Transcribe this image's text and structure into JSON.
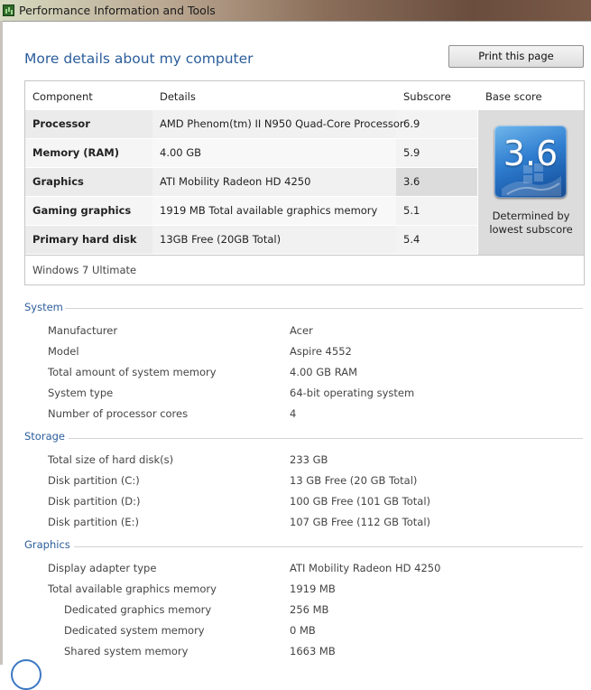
{
  "window": {
    "title": "Performance Information and Tools"
  },
  "page": {
    "title": "More details about my computer",
    "print_button": "Print this page"
  },
  "scores": {
    "headers": {
      "component": "Component",
      "details": "Details",
      "subscore": "Subscore",
      "base": "Base score"
    },
    "rows": [
      {
        "component": "Processor",
        "details": "AMD Phenom(tm) II N950 Quad-Core Processor",
        "subscore": "6.9"
      },
      {
        "component": "Memory (RAM)",
        "details": "4.00 GB",
        "subscore": "5.9"
      },
      {
        "component": "Graphics",
        "details": "ATI Mobility Radeon HD 4250",
        "subscore": "3.6"
      },
      {
        "component": "Gaming graphics",
        "details": "1919 MB Total available graphics memory",
        "subscore": "5.1"
      },
      {
        "component": "Primary hard disk",
        "details": "13GB Free (20GB Total)",
        "subscore": "5.4"
      }
    ],
    "base_score": "3.6",
    "base_caption_1": "Determined by",
    "base_caption_2": "lowest subscore",
    "os": "Windows 7 Ultimate"
  },
  "system": {
    "heading": "System",
    "items": [
      {
        "label": "Manufacturer",
        "value": "Acer"
      },
      {
        "label": "Model",
        "value": "Aspire 4552"
      },
      {
        "label": "Total amount of system memory",
        "value": "4.00 GB RAM"
      },
      {
        "label": "System type",
        "value": "64-bit operating system"
      },
      {
        "label": "Number of processor cores",
        "value": "4"
      }
    ]
  },
  "storage": {
    "heading": "Storage",
    "items": [
      {
        "label": "Total size of hard disk(s)",
        "value": "233 GB"
      },
      {
        "label": "Disk partition (C:)",
        "value": "13 GB Free (20 GB Total)"
      },
      {
        "label": "Disk partition (D:)",
        "value": "100 GB Free (101 GB Total)"
      },
      {
        "label": "Disk partition (E:)",
        "value": "107 GB Free (112 GB Total)"
      }
    ]
  },
  "graphics": {
    "heading": "Graphics",
    "items": [
      {
        "label": "Display adapter type",
        "value": "ATI Mobility Radeon HD 4250"
      },
      {
        "label": "Total available graphics memory",
        "value": "1919 MB"
      },
      {
        "label": "Dedicated graphics memory",
        "value": "256 MB"
      },
      {
        "label": "Dedicated system memory",
        "value": "0 MB"
      },
      {
        "label": "Shared system memory",
        "value": "1663 MB"
      }
    ]
  },
  "icons": {
    "app": "performance-chart-icon",
    "badge": "windows-flag-icon"
  },
  "colors": {
    "heading_blue": "#2b5d9b",
    "badge_blue": "#2f7dd0",
    "lowest_highlight": "#dcdcdc"
  }
}
